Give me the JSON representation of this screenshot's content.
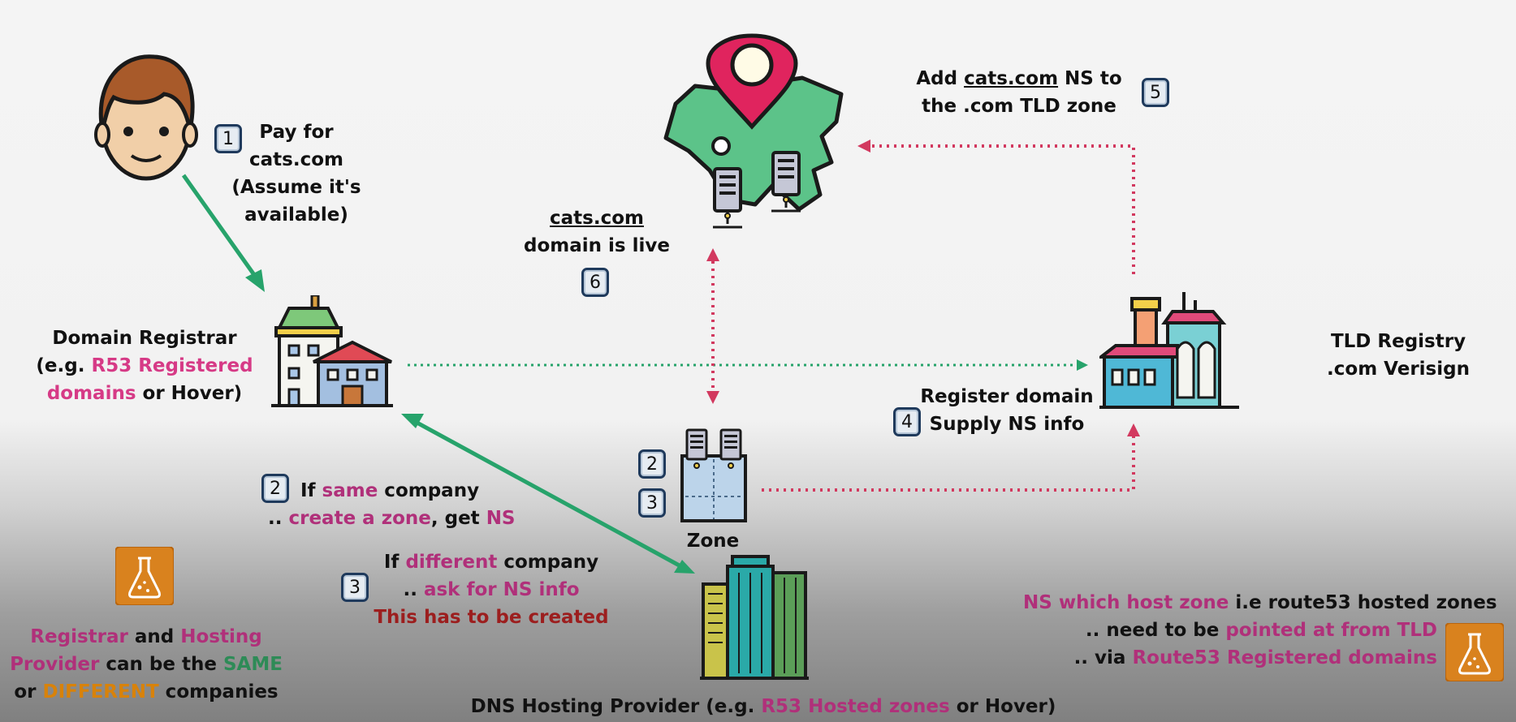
{
  "step1": {
    "badge": "1",
    "line1": "Pay for",
    "line2": "cats.com",
    "line3": "(Assume it's",
    "line4": "available)"
  },
  "registrar": {
    "line1": "Domain Registrar",
    "line2_a": "(e.g. ",
    "line2_b": "R53 Registered",
    "line3_a": "domains",
    "line3_b": " or Hover)"
  },
  "step2": {
    "badge": "2",
    "a": "If ",
    "b": "same",
    "c": " company",
    "d": ".. ",
    "e": "create a zone",
    "f": ", get ",
    "g": "NS"
  },
  "step3": {
    "badge": "3",
    "a": "If ",
    "b": "different",
    "c": " company",
    "d": ".. ",
    "e": "ask for NS info",
    "f": "This has to be created"
  },
  "zone": {
    "badge2": "2",
    "badge3": "3",
    "label": "Zone"
  },
  "live": {
    "line1": "cats.com",
    "line2": "domain is live",
    "badge": "6"
  },
  "step5": {
    "a": "Add ",
    "b": "cats.com",
    "c": " NS to",
    "line2": "the .com TLD zone",
    "badge": "5"
  },
  "step4": {
    "badge": "4",
    "line1": "Register domain",
    "line2": "Supply NS info"
  },
  "tld": {
    "line1": "TLD Registry",
    "line2": ".com Verisign"
  },
  "hosting": {
    "a": "DNS Hosting Provider (e.g. ",
    "b": "R53 Hosted zones",
    "c": " or Hover)"
  },
  "note_left": {
    "a": "Registrar",
    "b": " and ",
    "c": "Hosting",
    "d": "Provider",
    "e": " can be the ",
    "f": "SAME",
    "g": "or ",
    "h": "DIFFERENT",
    "i": " companies"
  },
  "note_right": {
    "a": "NS which host zone",
    "b": " i.e route53 hosted zones",
    "c": ".. need to be ",
    "d": "pointed at from TLD",
    "e": ".. via ",
    "f": "Route53 Registered domains"
  },
  "colors": {
    "green_arrow": "#27a36b",
    "red_arrow": "#d2395f",
    "pink": "#d63a86",
    "map_green": "#5cc389",
    "pin": "#e0245e"
  }
}
